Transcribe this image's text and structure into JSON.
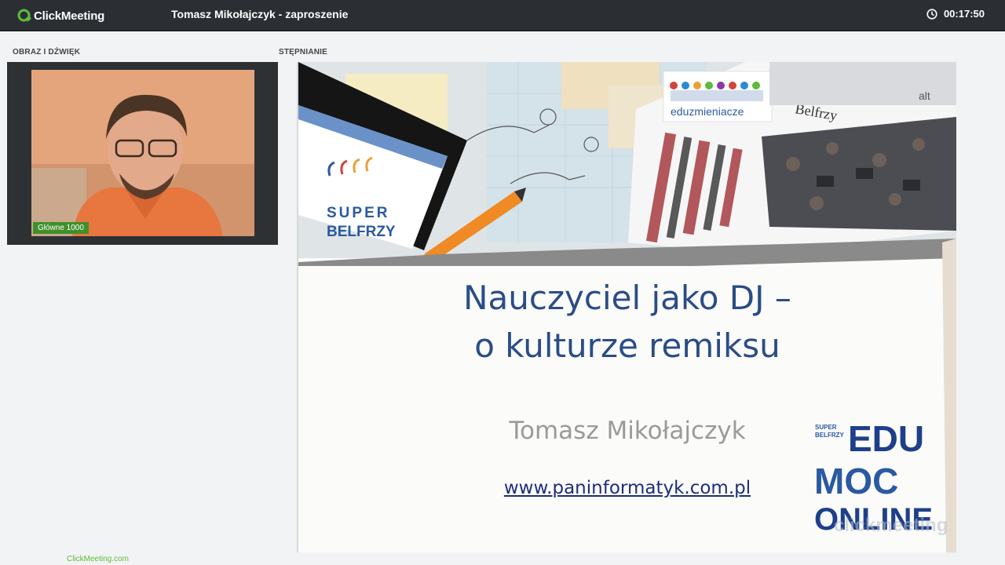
{
  "app": {
    "logo_text": "ClickMeeting",
    "session_title": "Tomasz Mikołajczyk - zaproszenie",
    "timer": "00:17:50",
    "icons": {
      "logo": "clickmeeting-logo-icon",
      "timer": "clock-icon"
    },
    "colors": {
      "topbar": "#2b2f33",
      "brand_green": "#5bbd3a",
      "slide_title": "#2a4d86"
    }
  },
  "av_section": {
    "label": "OBRAZ I DŹWIĘK",
    "participant_name": "Główne 1000"
  },
  "presentation_section": {
    "label": "STĘPNIANIE",
    "slide": {
      "logo_super": "SUPER",
      "logo_belfrzy": "BELFRZY",
      "logo_eduzmieniacze": "eduzmieniacze",
      "collage_text": "Belfrzy",
      "keyboard_key": "alt",
      "title_line1": "Nauczyciel jako DJ –",
      "title_line2": "o kulturze remiksu",
      "author": "Tomasz Mikołajczyk",
      "link": "www.paninformatyk.com.pl",
      "edumoc": {
        "line1": "EDU",
        "line2": "MOC",
        "line3": "ONLINE",
        "small_super": "SUPER",
        "small_belfrzy": "BELFRZY"
      },
      "watermark": "clickmeeting"
    }
  },
  "footer": {
    "link": "ClickMeeting.com"
  }
}
